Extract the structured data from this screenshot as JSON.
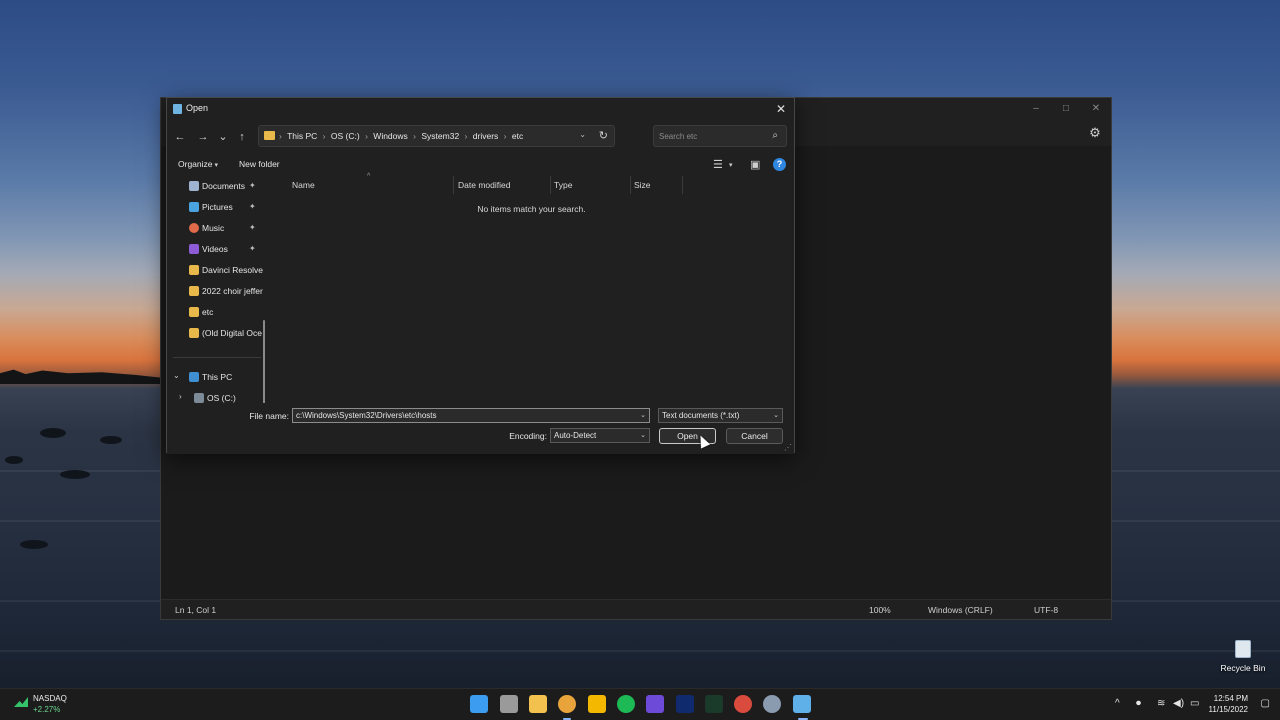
{
  "notepad": {
    "status": {
      "position": "Ln 1, Col 1",
      "zoom": "100%",
      "line_ending": "Windows (CRLF)",
      "encoding": "UTF-8"
    },
    "controls": {
      "minimize": "–",
      "maximize": "□",
      "close": "✕"
    },
    "settings_icon": "gear-icon"
  },
  "dialog": {
    "title": "Open",
    "close": "✕",
    "nav": {
      "back": "←",
      "forward": "→",
      "recent": "⌄",
      "up": "↑"
    },
    "breadcrumb": [
      "This PC",
      "OS (C:)",
      "Windows",
      "System32",
      "drivers",
      "etc"
    ],
    "breadcrumb_sep": "›",
    "search": {
      "placeholder": "Search etc"
    },
    "toolbar": {
      "organize": "Organize",
      "new_folder": "New folder"
    },
    "nav_pane": [
      {
        "label": "Documents",
        "icon": "documents-icon",
        "pinned": true,
        "color": "#9fb4d1"
      },
      {
        "label": "Pictures",
        "icon": "pictures-icon",
        "pinned": true,
        "color": "#4aa3df"
      },
      {
        "label": "Music",
        "icon": "music-icon",
        "pinned": true,
        "color": "#e06a4a"
      },
      {
        "label": "Videos",
        "icon": "videos-icon",
        "pinned": true,
        "color": "#8e5bd6"
      },
      {
        "label": "Davinci Resolve",
        "icon": "folder-icon",
        "pinned": false,
        "color": "#e9b84a"
      },
      {
        "label": "2022 choir jeffer",
        "icon": "folder-icon",
        "pinned": false,
        "color": "#e9b84a"
      },
      {
        "label": "etc",
        "icon": "folder-icon",
        "pinned": false,
        "color": "#e9b84a"
      },
      {
        "label": "(Old Digital Oce",
        "icon": "folder-icon",
        "pinned": false,
        "color": "#e9b84a"
      }
    ],
    "this_pc": {
      "label": "This PC",
      "expanded": true
    },
    "os_drive": {
      "label": "OS (C:)"
    },
    "columns": [
      "Name",
      "Date modified",
      "Type",
      "Size"
    ],
    "empty_message": "No items match your search.",
    "file_name_label": "File name:",
    "file_name_value": "c:\\Windows\\System32\\Drivers\\etc\\hosts",
    "file_type": "Text documents (*.txt)",
    "encoding_label": "Encoding:",
    "encoding_value": "Auto-Detect",
    "open_button": "Open",
    "cancel_button": "Cancel"
  },
  "desktop": {
    "recycle_bin": "Recycle Bin"
  },
  "taskbar": {
    "widget": {
      "name": "NASDAQ",
      "change": "+2.27%"
    },
    "apps": [
      {
        "name": "start-icon",
        "color": "#3b9cf0"
      },
      {
        "name": "task-view-icon",
        "color": "#9a9a9a"
      },
      {
        "name": "file-explorer-icon",
        "color": "#f2c14e"
      },
      {
        "name": "chrome-icon",
        "color": "#e8a43a"
      },
      {
        "name": "google-keep-icon",
        "color": "#f5b800"
      },
      {
        "name": "spotify-icon",
        "color": "#1db954"
      },
      {
        "name": "mastodon-icon",
        "color": "#6d4ad8"
      },
      {
        "name": "disney-plus-icon",
        "color": "#102a6e"
      },
      {
        "name": "hulu-icon",
        "color": "#1ce783"
      },
      {
        "name": "chrome-profile-icon",
        "color": "#d94b3d"
      },
      {
        "name": "settings-icon",
        "color": "#8a9bb0"
      },
      {
        "name": "notepad-icon",
        "color": "#5fb0e8"
      }
    ],
    "tray": {
      "chevron": "^",
      "mic": "🎙",
      "wifi": "≋",
      "volume": "🔊",
      "battery": "▭"
    },
    "time": "12:54 PM",
    "date": "11/15/2022",
    "notification": "🗨"
  }
}
